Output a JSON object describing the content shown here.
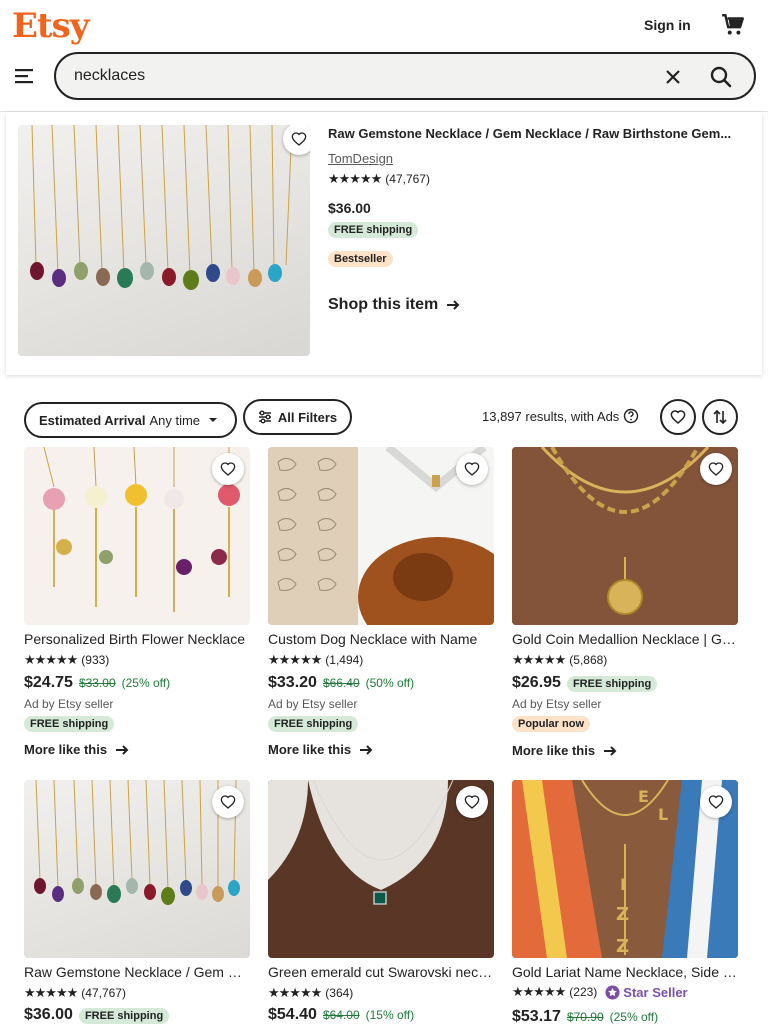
{
  "header": {
    "logo": "Etsy",
    "sign_in": "Sign in",
    "search_value": "necklaces"
  },
  "featured": {
    "title": "Raw Gemstone Necklace / Gem Necklace / Raw Birthstone Gem...",
    "shop": "TomDesign",
    "stars": "★★★★★",
    "review_count": "(47,767)",
    "price": "$36.00",
    "shipping": "FREE shipping",
    "badge": "Bestseller",
    "cta": "Shop this item"
  },
  "filters": {
    "estimated_label": "Estimated Arrival",
    "estimated_value": "Any time",
    "all_filters": "All Filters",
    "results": "13,897 results, with Ads"
  },
  "listings": [
    {
      "title": "Personalized Birth Flower Necklace",
      "stars": "★★★★★",
      "reviews": "(933)",
      "price": "$24.75",
      "orig": "$33.00",
      "off": "(25% off)",
      "ad": "Ad by Etsy seller",
      "badge": "FREE shipping",
      "more": "More like this"
    },
    {
      "title": "Custom Dog Necklace with Name",
      "stars": "★★★★★",
      "reviews": "(1,494)",
      "price": "$33.20",
      "orig": "$66.40",
      "off": "(50% off)",
      "ad": "Ad by Etsy seller",
      "badge": "FREE shipping",
      "more": "More like this"
    },
    {
      "title": "Gold Coin Medallion Necklace | Gold",
      "stars": "★★★★★",
      "reviews": "(5,868)",
      "price": "$26.95",
      "shipping": "FREE shipping",
      "ad": "Ad by Etsy seller",
      "badge": "Popular now",
      "more": "More like this"
    },
    {
      "title": "Raw Gemstone Necklace / Gem Necklace",
      "stars": "★★★★★",
      "reviews": "(47,767)",
      "price": "$36.00",
      "shipping": "FREE shipping"
    },
    {
      "title": "Green emerald cut Swarovski necklace",
      "stars": "★★★★★",
      "reviews": "(364)",
      "price": "$54.40",
      "orig": "$64.00",
      "off": "(15% off)"
    },
    {
      "title": "Gold Lariat Name Necklace, Side Initial",
      "stars": "★★★★★",
      "reviews": "(223)",
      "star_seller": "Star Seller",
      "price": "$53.17",
      "orig": "$70.90",
      "off": "(25% off)"
    }
  ]
}
